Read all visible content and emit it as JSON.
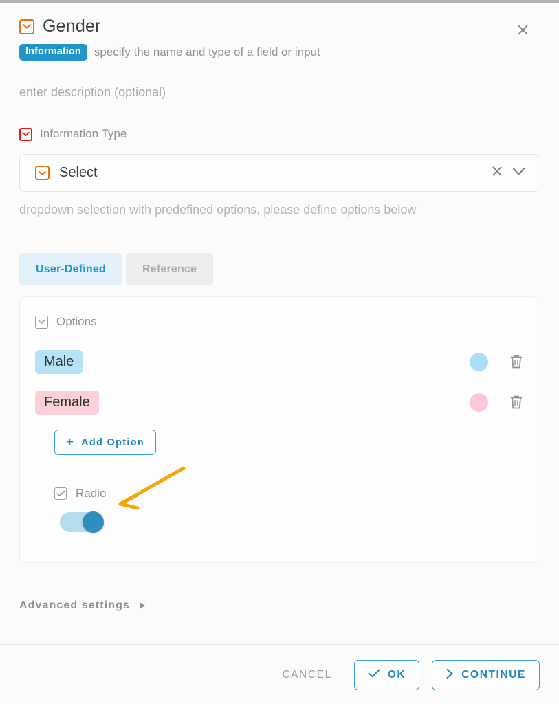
{
  "dialog": {
    "title": "Gender",
    "title_icon": "select-field-icon",
    "close_icon": "close-icon",
    "badge": "Information",
    "subtitle": "specify the name and type of a field or input",
    "description_placeholder": "enter description (optional)",
    "badge_color": "#2196c9",
    "accent_color": "#2787b8",
    "title_icon_color": "#e8710a"
  },
  "info_type": {
    "label": "Information Type",
    "label_icon": "select-field-icon-red",
    "value": "Select",
    "value_icon": "select-field-icon-orange",
    "clear_icon": "clear-icon",
    "expand_icon": "chevron-down-icon",
    "hint": "dropdown selection with predefined options, please define options below"
  },
  "tabs": [
    {
      "label": "User-Defined",
      "active": true
    },
    {
      "label": "Reference",
      "active": false
    }
  ],
  "options_panel": {
    "label": "Options",
    "label_icon": "select-field-icon-gray",
    "items": [
      {
        "label": "Male",
        "chip_color": "#b4e3f7",
        "swatch_color": "#abddf5",
        "delete_icon": "trash-icon"
      },
      {
        "label": "Female",
        "chip_color": "#fbd0d7",
        "swatch_color": "#fbc9d3",
        "delete_icon": "trash-icon"
      }
    ],
    "add_option": {
      "label": "Add Option",
      "icon": "plus-icon"
    },
    "radio": {
      "label": "Radio",
      "checked": true,
      "checkbox_icon": "checkbox-checked-icon"
    },
    "toggle": {
      "on": true,
      "track_color": "#b5ddf0",
      "thumb_color": "#2e8fbd"
    }
  },
  "annotation": {
    "arrow_color": "#f5a507",
    "points_at": "radio-toggle"
  },
  "advanced": {
    "label": "Advanced settings",
    "icon": "triangle-right-icon"
  },
  "footer": {
    "cancel": "CANCEL",
    "ok": "OK",
    "ok_icon": "check-icon",
    "continue": "CONTINUE",
    "continue_icon": "chevron-right-icon"
  }
}
